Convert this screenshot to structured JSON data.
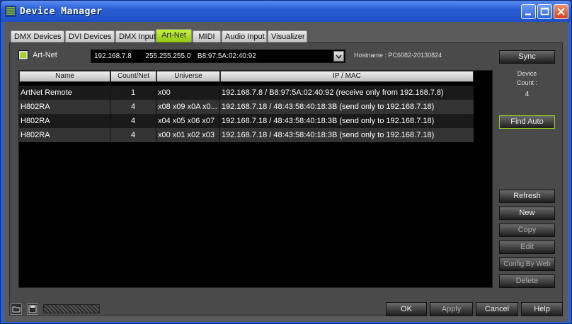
{
  "window": {
    "title": "Device Manager"
  },
  "tabs": [
    {
      "label": "DMX Devices"
    },
    {
      "label": "DVI Devices"
    },
    {
      "label": "DMX Input"
    },
    {
      "label": "Art-Net",
      "active": true
    },
    {
      "label": "MIDI"
    },
    {
      "label": "Audio Input"
    },
    {
      "label": "Visualizer"
    }
  ],
  "artnet": {
    "enable_label": "Art-Net",
    "enabled": true,
    "adapter": {
      "ip": "192.168.7.8",
      "mask": "255.255.255.0",
      "mac": "B8:97:5A:02:40:92"
    },
    "hostname_label": "Hostname :",
    "hostname": "PC6082-20130824"
  },
  "table": {
    "columns": [
      "Name",
      "Count/Net",
      "Universe",
      "IP / MAC"
    ],
    "rows": [
      [
        "ArtNet Remote",
        "1",
        "x00",
        "192.168.7.8 / B8:97:5A:02:40:92 (receive only from 192.168.7.8)"
      ],
      [
        "H802RA",
        "4",
        "x08 x09 x0A x0...",
        "192.168.7.18 / 48:43:58:40:18:3B (send only to 192.168.7.18)"
      ],
      [
        "H802RA",
        "4",
        "x04 x05 x06 x07",
        "192.168.7.18 / 48:43:58:40:18:3B (send only to 192.168.7.18)"
      ],
      [
        "H802RA",
        "4",
        "x00 x01 x02 x03",
        "192.168.7.18 / 48:43:58:40:18:3B (send only to 192.168.7.18)"
      ]
    ]
  },
  "side": {
    "sync": "Sync",
    "device_count_label_1": "Device",
    "device_count_label_2": "Count :",
    "device_count": "4",
    "find_auto": "Find Auto",
    "refresh": "Refresh",
    "new": "New",
    "copy": "Copy",
    "edit": "Edit",
    "config_by_web": "Config By Web",
    "delete": "Delete"
  },
  "footer": {
    "ok": "OK",
    "apply": "Apply",
    "cancel": "Cancel",
    "help": "Help"
  },
  "colors": {
    "accent": "#9ad214",
    "titlebar": "#2b5fd6",
    "panel": "#4a4a4a"
  }
}
